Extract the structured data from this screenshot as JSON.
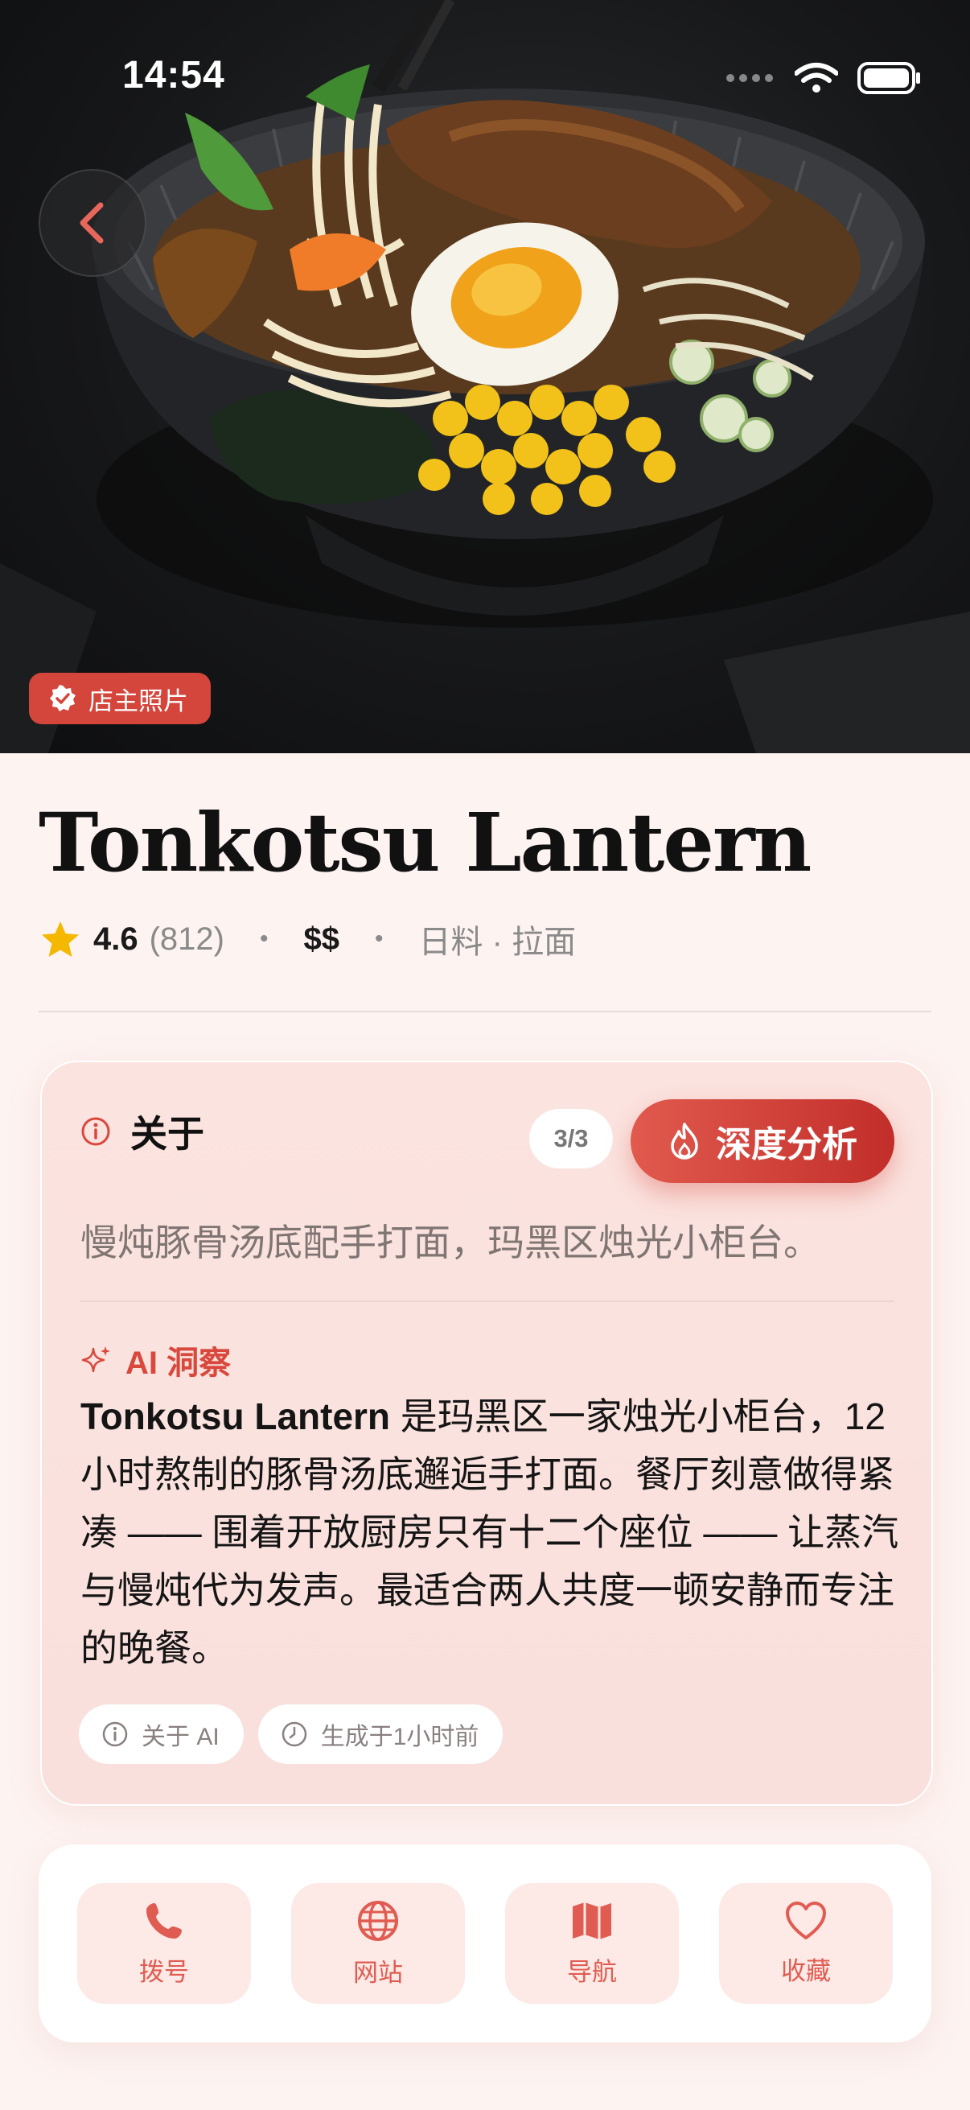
{
  "status_bar": {
    "time": "14:54"
  },
  "hero": {
    "badge_label": "店主照片"
  },
  "restaurant": {
    "name": "Tonkotsu Lantern",
    "rating": "4.6",
    "review_count": "(812)",
    "separator": "•",
    "price": "$$",
    "category": "日料 · 拉面"
  },
  "about": {
    "title": "关于",
    "page_indicator": "3/3",
    "deep_analysis_label": "深度分析",
    "summary": "慢炖豚骨汤底配手打面，玛黑区烛光小柜台。",
    "ai_title": "AI 洞察",
    "ai_insight_brand": "Tonkotsu Lantern",
    "ai_insight_text": " 是玛黑区一家烛光小柜台，12小时熬制的豚骨汤底邂逅手打面。餐厅刻意做得紧凑 —— 围着开放厨房只有十二个座位 —— 让蒸汽与慢炖代为发声。最适合两人共度一顿安静而专注的晚餐。",
    "chips": {
      "about_ai": "关于 AI",
      "generated": "生成于1小时前"
    }
  },
  "actions": {
    "call": "拨号",
    "website": "网站",
    "navigate": "导航",
    "save": "收藏"
  },
  "colors": {
    "accent": "#d9483d",
    "accent_light": "#fde9e5",
    "background": "#fdf3f1",
    "star": "#f5b800"
  },
  "icons": [
    "back-chevron-icon",
    "verified-icon",
    "star-icon",
    "info-icon",
    "flame-icon",
    "sparkle-icon",
    "clock-icon",
    "phone-icon",
    "globe-icon",
    "map-icon",
    "heart-icon"
  ]
}
